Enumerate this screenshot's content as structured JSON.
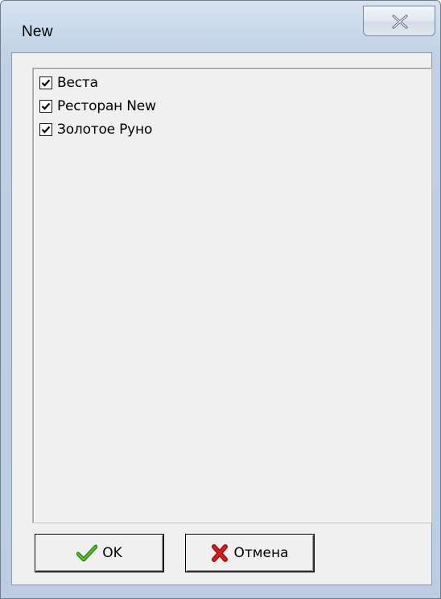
{
  "window": {
    "title": "New"
  },
  "checklist": {
    "items": [
      {
        "label": "Веста",
        "checked": true
      },
      {
        "label": "Ресторан New",
        "checked": true
      },
      {
        "label": "Золотое Руно",
        "checked": true
      }
    ]
  },
  "buttons": {
    "ok_label": "OK",
    "cancel_label": "Отмена"
  },
  "colors": {
    "ok_icon": "#2e8b16",
    "cancel_icon": "#c81414"
  },
  "icons": {
    "close": "close-icon",
    "ok": "checkmark-icon",
    "cancel": "x-icon"
  }
}
